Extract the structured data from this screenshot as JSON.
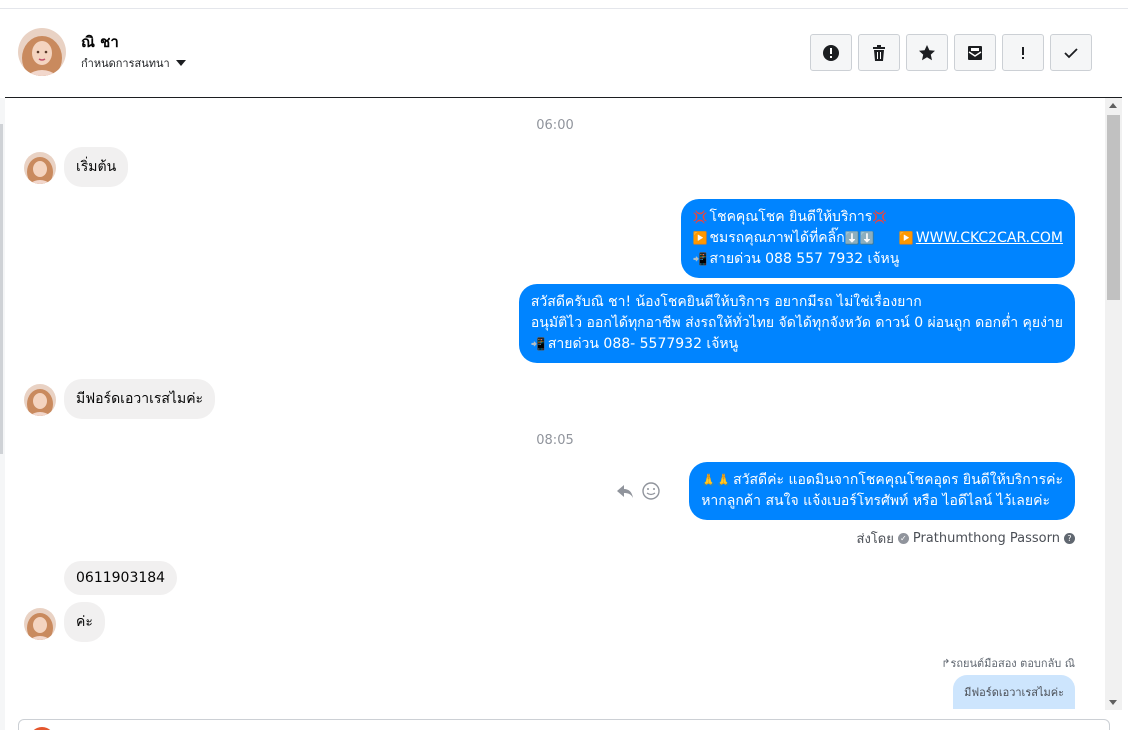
{
  "header": {
    "name": "ณิ ชา",
    "subtitle": "กำหนดการสนทนา",
    "actions": [
      {
        "icon": "alert-circle-icon",
        "label": "Report"
      },
      {
        "icon": "trash-icon",
        "label": "Delete"
      },
      {
        "icon": "star-icon",
        "label": "Star"
      },
      {
        "icon": "mail-icon",
        "label": "Mark as unread"
      },
      {
        "icon": "exclamation-icon",
        "label": "Mark as spam"
      },
      {
        "icon": "check-icon",
        "label": "Done"
      }
    ]
  },
  "messages": {
    "time1": "06:00",
    "in1": "เริ่มต้น",
    "out1_line1": "โชคคุณโชค ยินดีให้บริการ",
    "out1_line2": "ชมรถคุณภาพได้ที่คลิ๊ก",
    "out1_link": "WWW.CKC2CAR.COM",
    "out1_line3": "สายด่วน 088 557 7932 เจ้หนู",
    "out2_line1": "สวัสดีครับณิ ชา! น้องโชคยินดีให้บริการ อยากมีรถ ไม่ใช่เรื่องยาก",
    "out2_line2": "อนุมัติไว ออกได้ทุกอาชีพ ส่งรถให้ทั่วไทย จัดได้ทุกจังหวัด ดาวน์ 0  ผ่อนถูก ดอกต่ำ คุยง่าย",
    "out2_line3": "สายด่วน 088- 5577932 เจ้หนู",
    "in2": "มีฟอร์ดเอวาเรสไมค่ะ",
    "time2": "08:05",
    "out3_line1": "สวัสดีค่ะ แอดมินจากโชคคุณโชคอุดร ยินดีให้บริการค่ะ",
    "out3_line2": "หากลูกค้า สนใจ แจ้งเบอร์โทรศัพท์ หรือ ไอดีไลน์  ไว้เลยค่ะ",
    "sent_by_prefix": "ส่งโดย",
    "sent_by_name": "Prathumthong Passorn",
    "in3": "0611903184",
    "in4": "ค่ะ",
    "reply_note": "รถยนต์มือสอง ตอบกลับ ณิ",
    "reply_quote": "มีฟอร์ดเอวาเรสไมค่ะ"
  },
  "colors": {
    "outgoing": "#0084ff",
    "incoming": "#f1f0f0",
    "reply_quote": "#cde5fd"
  }
}
